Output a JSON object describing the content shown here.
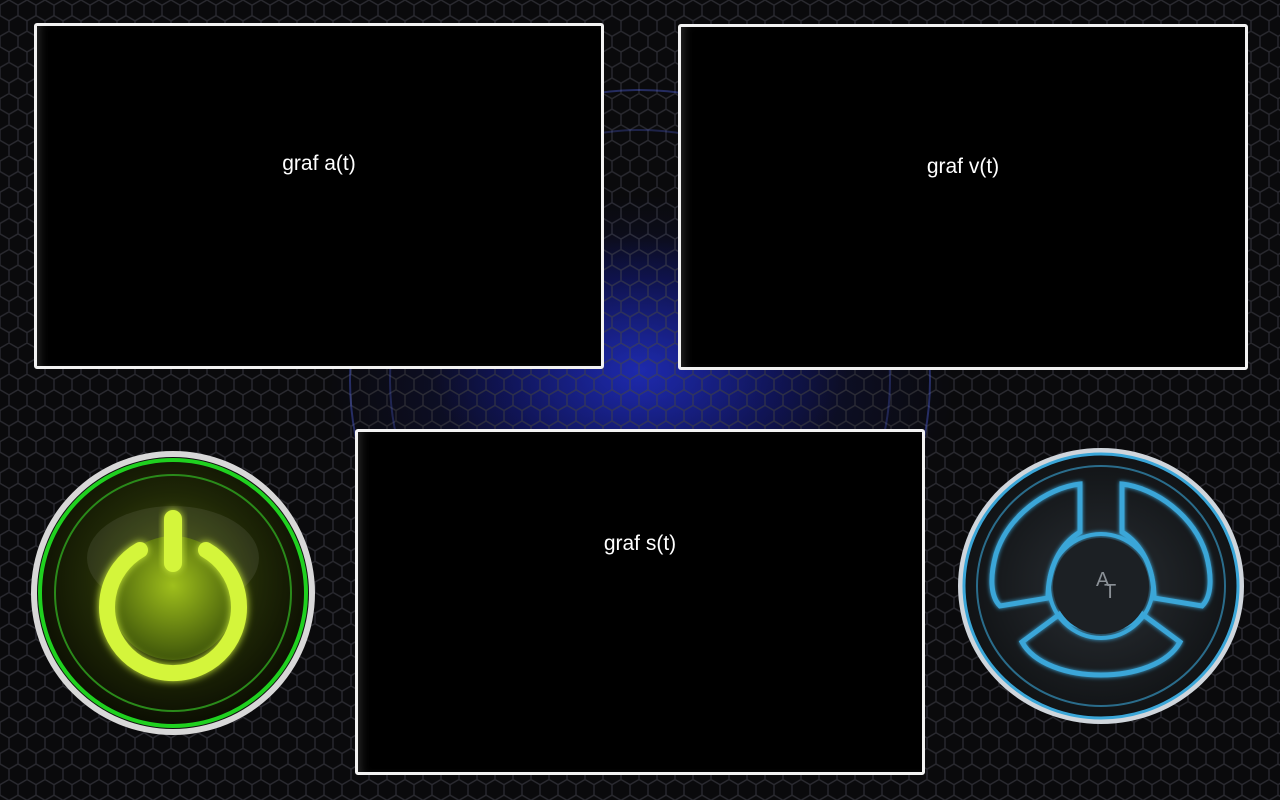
{
  "graphs": {
    "acceleration": {
      "title": "graf a(t)"
    },
    "velocity": {
      "title": "graf v(t)"
    },
    "position": {
      "title": "graf s(t)"
    }
  },
  "buttons": {
    "power": {
      "icon": "power-icon",
      "color": "#c8f02a"
    },
    "steering": {
      "icon": "steering-wheel-icon",
      "color": "#3aa6d8",
      "logo_top": "A",
      "logo_bottom": "T"
    }
  },
  "theme": {
    "background": "#0a0a0c",
    "glow": "#2a3cff",
    "panel_border": "#f2f2f2"
  }
}
